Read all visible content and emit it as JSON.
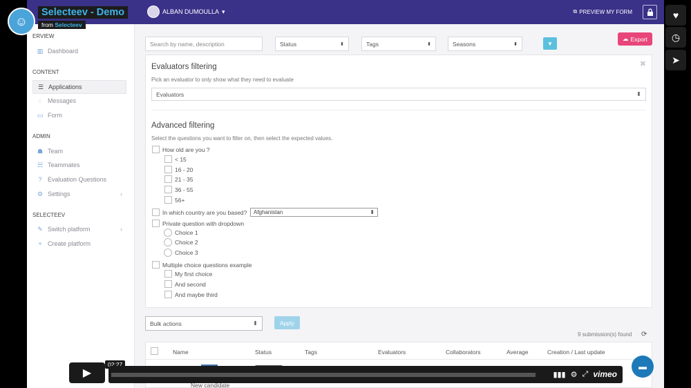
{
  "video": {
    "title": "Selecteev - Demo",
    "from_prefix": "from",
    "from_name": "Selecteev",
    "time": "02:27",
    "brand": "vimeo"
  },
  "topbar": {
    "user": "ALBAN DUMOULLA",
    "preview": "PREVIEW MY FORM"
  },
  "sidebar": {
    "overview_label": "ERVIEW",
    "dashboard": "Dashboard",
    "content_label": "CONTENT",
    "applications": "Applications",
    "messages": "Messages",
    "form": "Form",
    "admin_label": "ADMIN",
    "team": "Team",
    "teammates": "Teammates",
    "evaluation_questions": "Evaluation Questions",
    "settings": "Settings",
    "selecteev_label": "SELECTEEV",
    "switch_platform": "Switch platform",
    "create_platform": "Create platform"
  },
  "filters": {
    "search_placeholder": "Search by name, description",
    "status": "Status",
    "tags": "Tags",
    "seasons": "Seasons",
    "export": "Export"
  },
  "panel": {
    "evaluators_heading": "Evaluators filtering",
    "evaluators_sub": "Pick an evaluator to only show what they need to evaluate",
    "evaluators_select": "Evaluators",
    "advanced_heading": "Advanced filtering",
    "advanced_sub": "Select the questions you want to filter on, then select the expected values.",
    "q_age": "How old are you ?",
    "age_options": [
      "< 15",
      "16 - 20",
      "21 - 35",
      "36 - 55",
      "56+"
    ],
    "q_country": "In which country are you based?",
    "country_value": "Afghanistan",
    "q_private": "Private question with dropdown",
    "private_options": [
      "Choice 1",
      "Choice 2",
      "Choice 3"
    ],
    "q_multi": "Multiple choice questions example",
    "multi_options": [
      "My first choice",
      "And second",
      "And maybe third"
    ]
  },
  "bulk": {
    "label": "Bulk actions",
    "apply": "Apply",
    "found": "9 submission(s) found"
  },
  "table": {
    "headers": [
      "Name",
      "Status",
      "Tags",
      "Evaluators",
      "Collaborators",
      "Average",
      "Creation / Last update"
    ],
    "first_row_name": "New candidate"
  }
}
